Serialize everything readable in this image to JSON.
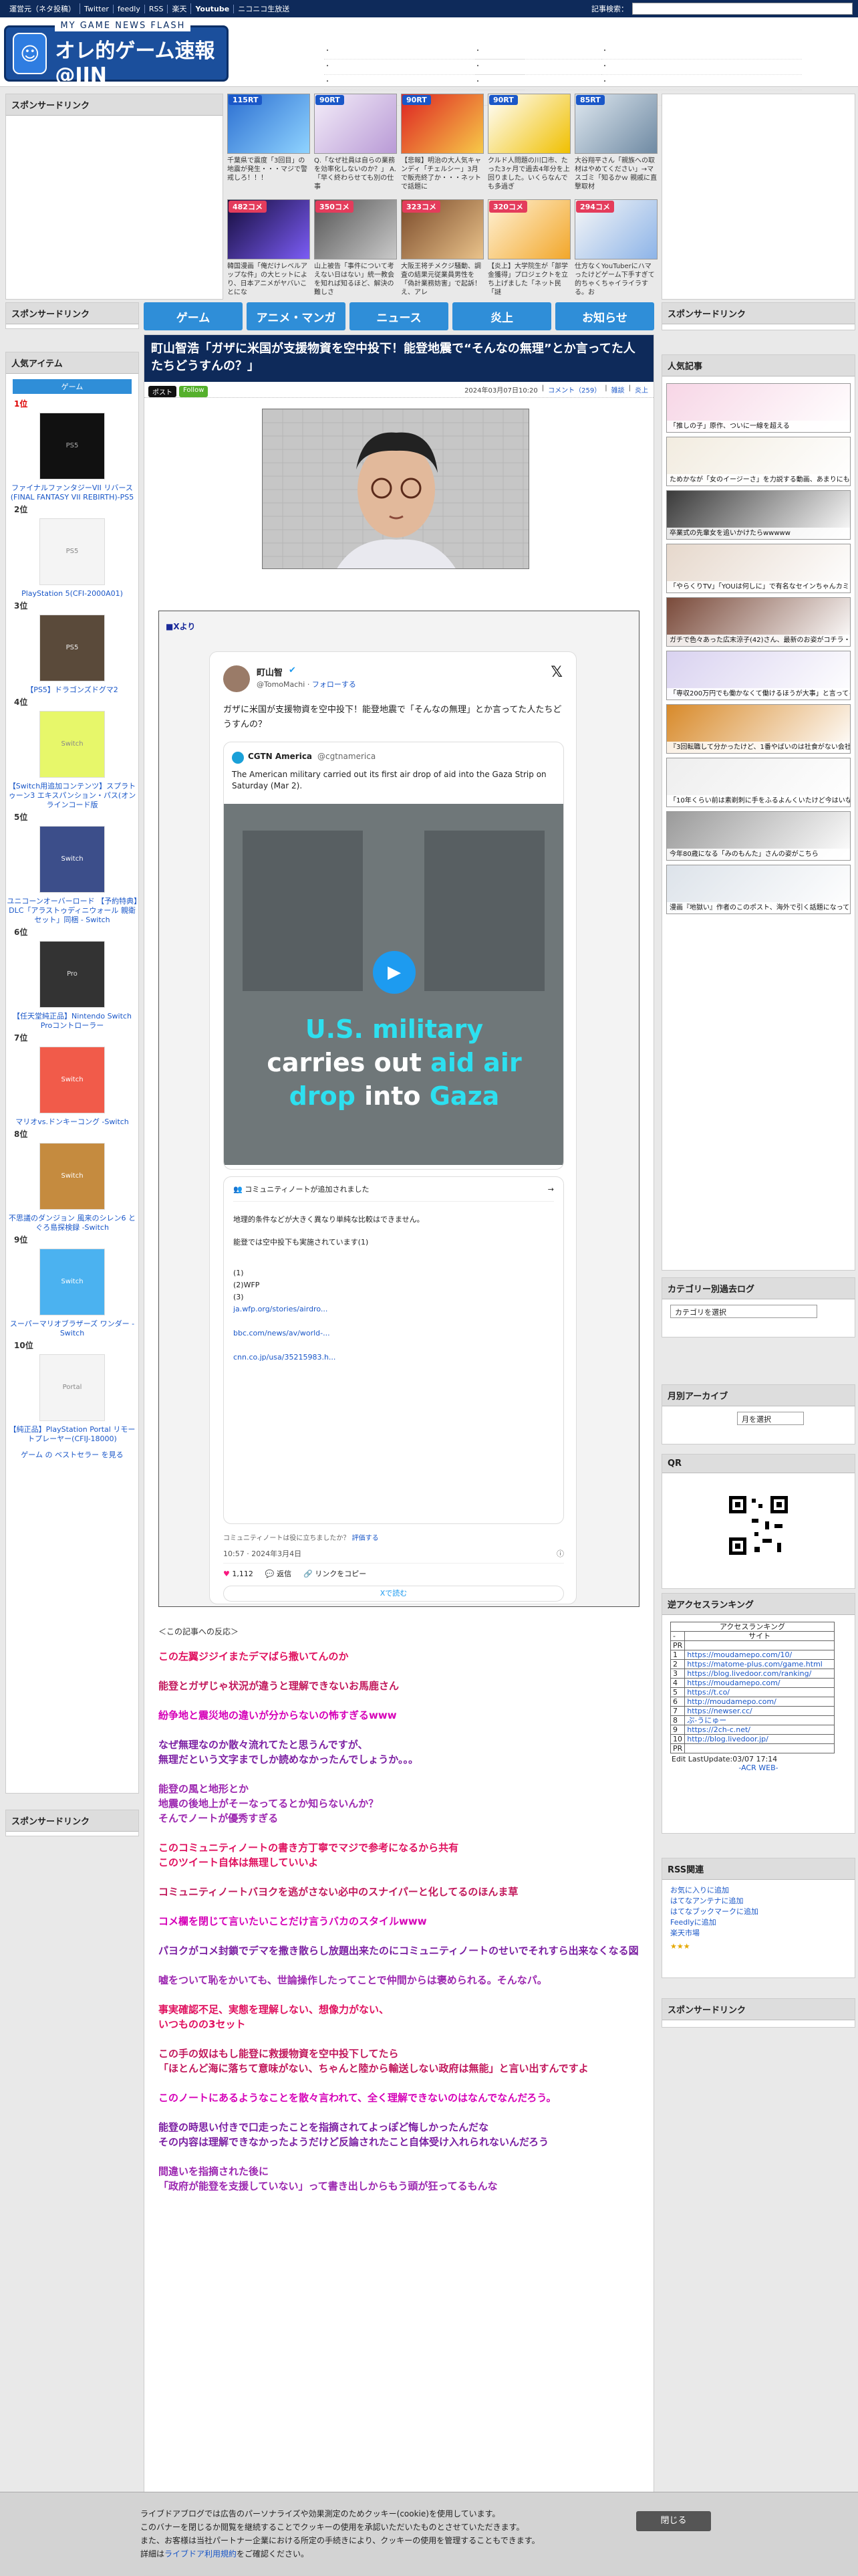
{
  "topbar": {
    "links": [
      "運営元（ネタ投稿）",
      "Twitter",
      "feedly",
      "RSS",
      "楽天",
      "Youtube",
      "ニコニコ生放送"
    ],
    "search_label": "記事検索："
  },
  "header": {
    "logo_top": "MY GAME NEWS FLASH",
    "logo_main": "オレ的ゲーム速報@JIN",
    "news_col1": [
      "・",
      "・",
      "・",
      "・"
    ],
    "news_col2": [
      "・",
      "・",
      "・",
      "・"
    ],
    "news_col3": [
      "・",
      "・",
      "・",
      "・"
    ]
  },
  "thumbs": [
    {
      "badge": "115RT",
      "caption": "千葉県で震度「3回目」の地震が発生・・・マジで警戒しろ！！！"
    },
    {
      "badge": "90RT",
      "caption": "Q.「なぜ社員は自らの業務を効率化しないのか？」 A.「早く終わらせても別の仕事"
    },
    {
      "badge": "90RT",
      "caption": "【悲報】明治の大人気キャンディ「チェルシー」3月で販売終了か・・・ネットで話題に"
    },
    {
      "badge": "90RT",
      "caption": "クルド人問題の川口市、たった3ヶ月で過去4年分を上回りました。いくらなんでも多過ぎ"
    },
    {
      "badge": "85RT",
      "caption": "大谷翔平さん「親族への取材はやめてください」→マスゴミ「知るかｗ 親戚に直撃取材"
    },
    {
      "badge": "482コメ",
      "caption": "韓国漫画「俺だけレベルアップな件」の大ヒットにより、日本アニメがヤバいことにな"
    },
    {
      "badge": "350コメ",
      "caption": "山上被告「事件について考えない日はない」統一教会を知れば知るほど、解決の難しさ"
    },
    {
      "badge": "323コメ",
      "caption": "大阪王将チメクジ騒動、調査の結果元従業員男性を「偽計業務妨害」で起訴！え、アレ"
    },
    {
      "badge": "320コメ",
      "caption": "【炎上】大学院生が「部学金獲得」プロジェクトを立ち上げました「ネット民「謎"
    },
    {
      "badge": "294コメ",
      "caption": "仕方なくYouTuberにハマったけどゲーム下手すぎて的ちゃくちゃイライラする。お"
    }
  ],
  "sponsored_label": "スポンサードリンク",
  "nav": [
    "ゲーム",
    "アニメ・マンガ",
    "ニュース",
    "炎上",
    "お知らせ"
  ],
  "article": {
    "title": "町山智浩「ガザに米国が支援物資を空中投下！能登地震で“そんなの無理”とか言ってた人たちどうすんの？」",
    "date": "2024年03月07日10:20",
    "comments": "コメント（259）",
    "cat1": "雑談",
    "cat2": "炎上",
    "share_x": "ポスト",
    "share_follow": "Follow",
    "embed_label": "■Xより",
    "tweet": {
      "name": "町山智",
      "handle": "@TomoMachi",
      "follow": "フォローする",
      "text": "ガザに米国が支援物資を空中投下！能登地震で「そんなの無理」とか言ってた人たちどうすんの？",
      "quote_name": "CGTN America",
      "quote_handle": "@cgtnamerica",
      "quote_text": "The American military carried out its first air drop of aid into the Gaza Strip on Saturday (Mar 2).",
      "video_line1": "U.S. military",
      "video_line2a": "carries out ",
      "video_line2b": "aid air",
      "video_line3a": "drop",
      "video_line3b": " into ",
      "video_line3c": "Gaza",
      "note_title": "コミュニティノートが追加されました",
      "note_l1": "地理的条件などが大きく異なり単純な比較はできません。",
      "note_l2": "能登では空中投下も実施されています(1)",
      "note_refs": [
        "(1)",
        "(2)WFP",
        "(3)",
        "",
        "",
        ""
      ],
      "note_link1": "ja.wfp.org/stories/airdro...",
      "note_l3": "",
      "note_link2": "bbc.com/news/av/world-...",
      "note_l4": "",
      "note_link3": "cnn.co.jp/usa/35215983.h...",
      "note_footer": "コミュニティノートは役に立ちましたか？",
      "note_footer_link": "評価する",
      "time": "10:57 · 2024年3月4日",
      "likes": "1,112",
      "reply": "返信",
      "copy": "リンクをコピー",
      "read_more": "Xで読む"
    }
  },
  "reactions": {
    "lead": "＜この記事への反応＞",
    "items": [
      {
        "text": "この左翼ジジイまたデマばら撒いてんのか",
        "color": "#e0115f"
      },
      {
        "text": "能登とガザじゃ状況が違うと理解できないお馬鹿さん",
        "color": "#c2185b"
      },
      {
        "text": "紛争地と震災地の違いが分からないの怖すぎるwww",
        "color": "#d600b8"
      },
      {
        "text": "なぜ無理なのか散々流れてたと思うんですが、\n無理だという文字までしか読めなかったんでしょうか。。。",
        "color": "#7b1fa2"
      },
      {
        "text": "能登の風と地形とか\n地震の後地上がそーなってるとか知らないんか？\nそんでノートが優秀すぎる",
        "color": "#9c27b0"
      },
      {
        "text": "このコミュニティノートの書き方丁寧でマジで参考になるから共有\nこのツイート自体は無理していいよ",
        "color": "#e0115f"
      },
      {
        "text": "コミュニティノートバヨクを逃がさない必中のスナイパーと化してるのほんま草",
        "color": "#c2185b"
      },
      {
        "text": "コメ欄を閉じて言いたいことだけ言うバカのスタイルwww",
        "color": "#d600b8"
      },
      {
        "text": "パヨクがコメ封鎖でデマを撒き散らし放題出来たのにコミュニティノートのせいでそれすら出来なくなる図",
        "color": "#7b1fa2"
      },
      {
        "text": "嘘をついて恥をかいても、世論操作したってことで仲間からは褒められる。そんなパ。",
        "color": "#9c27b0"
      },
      {
        "text": "事実確認不足、実態を理解しない、想像力がない、\nいつものの3セット",
        "color": "#e0115f"
      },
      {
        "text": "この手の奴はもし能登に救援物資を空中投下してたら\n「ほとんど海に落ちて意味がない、ちゃんと陸から輸送しない政府は無能」と言い出すんですよ",
        "color": "#c2185b"
      },
      {
        "text": "このノートにあるようなことを散々言われて、全く理解できないのはなんでなんだろう。",
        "color": "#d600b8"
      },
      {
        "text": "能登の時思い付きで口走ったことを指摘されてよっぽど悔しかったんだな\nその内容は理解できなかったようだけど反論されたこと自体受け入れられないんだろう",
        "color": "#7b1fa2"
      },
      {
        "text": "間違いを指摘された後に\n「政府が能登を支援していない」って書き出しからもう頭が狂ってるもんな",
        "color": "#9c27b0"
      }
    ]
  },
  "left": {
    "popular_title": "人気アイテム",
    "tab": "ゲーム",
    "items": [
      {
        "pos": "1位",
        "name": "ファイナルファンタジーVII リバース(FINAL FANTASY VII REBIRTH)-PS5"
      },
      {
        "pos": "2位",
        "name": "PlayStation 5(CFI-2000A01)"
      },
      {
        "pos": "3位",
        "name": "【PS5】ドラゴンズドグマ2"
      },
      {
        "pos": "4位",
        "name": "【Switch用追加コンテンツ】スプラトゥーン3 エキスパンション・パス(オンラインコード版"
      },
      {
        "pos": "5位",
        "name": "ユニコーンオーバーロード 【予約特典】DLC「アラストゥディニウォール 親衛セット」同梱 - Switch"
      },
      {
        "pos": "6位",
        "name": "【任天堂純正品】Nintendo Switch Proコントローラー"
      },
      {
        "pos": "7位",
        "name": "マリオvs.ドンキーコング -Switch"
      },
      {
        "pos": "8位",
        "name": "不思議のダンジョン 風来のシレン6 とぐろ島探検録 -Switch"
      },
      {
        "pos": "9位",
        "name": "スーパーマリオブラザーズ ワンダー -Switch"
      },
      {
        "pos": "10位",
        "name": "【純正品】PlayStation Portal リモートプレーヤー(CFIJ-18000)"
      }
    ],
    "more": "ゲーム の ベストセラー を見る"
  },
  "right": {
    "popular_title": "人気記事",
    "popular": [
      "「推しの子」原作、ついに一線を超える",
      "ためかなが「女のイージーさ」を力説する動画、あまりにも説得力がありすぎると話題に",
      "卒業式の先輩女を追いかけたらwwwww",
      "「やらくりTV」「YOUは何しに」で有名なセインちゃんカミュスに、現在の姿が衝撃すぎると話題に",
      "ガチで色々あった広末涼子(42)さん、最新のお姿がコチラ・・・",
      "「専収200万円でも働かなくて働けるほうが大事」と言ってる人、残酷な現実がこちら",
      "『3回転職して分かったけど、1番やばいのは社食がない会社』←これが真理",
      "「10年くらい前は素剃刺に手をふるよんくいたけど今はいない」←あるのか？",
      "今年80歳になる「みのもんた」さんの姿がこちら",
      "漫画『地獄い』作者のこのポスト、海外で引く話題になってしまう"
    ],
    "category_title": "カテゴリー別過去ログ",
    "category_select": "カテゴリを選択",
    "monthly_title": "月別アーカイブ",
    "monthly_select": "月を選択",
    "qr_title": "QR",
    "access_title": "逆アクセスランキング",
    "access_head1": "アクセスランキング",
    "access_head2": "サイト",
    "access_rows": [
      {
        "n": "1",
        "s": "https://moudamepo.com/10/"
      },
      {
        "n": "2",
        "s": "https://matome-plus.com/game.html"
      },
      {
        "n": "3",
        "s": "https://blog.livedoor.com/ranking/"
      },
      {
        "n": "4",
        "s": "https://moudamepo.com/"
      },
      {
        "n": "5",
        "s": "https://t.co/"
      },
      {
        "n": "6",
        "s": "http://moudamepo.com/"
      },
      {
        "n": "7",
        "s": "https://newser.cc/"
      },
      {
        "n": "8",
        "s": "ぷ-うにゅー"
      },
      {
        "n": "9",
        "s": "https://2ch-c.net/"
      },
      {
        "n": "10",
        "s": "http://blog.livedoor.jp/"
      }
    ],
    "access_footer": "Edit LastUpdate:03/07 17:14",
    "access_footer2": "-ACR WEB-",
    "rss_title": "RSS関連",
    "rss_links": [
      "お気に入りに追加",
      "はてなアンテナに追加",
      "はてなブックマークに追加",
      "Feedlyに追加",
      "楽天市場"
    ]
  },
  "consent": {
    "line1": "ライブドアブログでは広告のパーソナライズや効果測定のためクッキー(cookie)を使用しています。",
    "line2": "このバナーを閉じるか閲覧を継続することでクッキーの使用を承認いただいたものとさせていただきます。",
    "line3": "また、お客様は当社パートナー企業における所定の手続きにより、クッキーの使用を管理することもできます。",
    "line4_pre": "詳細は",
    "line4_link": "ライブドア利用規約",
    "line4_post": "をご確認ください。",
    "close": "閉じる"
  }
}
